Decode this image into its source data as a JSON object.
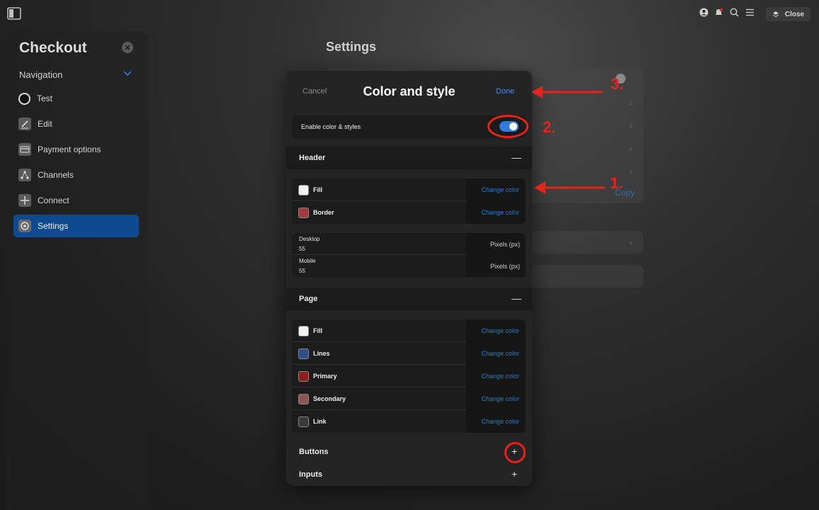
{
  "topbar": {
    "close_label": "Close"
  },
  "sidebar": {
    "title": "Checkout",
    "nav_label": "Navigation",
    "items": [
      {
        "label": "Test",
        "icon": "circle-icon"
      },
      {
        "label": "Edit",
        "icon": "edit-icon"
      },
      {
        "label": "Payment options",
        "icon": "card-icon"
      },
      {
        "label": "Channels",
        "icon": "channels-icon"
      },
      {
        "label": "Connect",
        "icon": "plus-icon"
      },
      {
        "label": "Settings",
        "icon": "gear-icon",
        "active": true
      }
    ]
  },
  "background": {
    "title": "Settings",
    "copy_label": "Copy"
  },
  "modal": {
    "cancel": "Cancel",
    "title": "Color and style",
    "done": "Done",
    "enable_label": "Enable color & styles",
    "enable_on": true,
    "header": {
      "label": "Header",
      "colors": [
        {
          "name": "Fill",
          "swatch": "#f2f2f2",
          "action": "Change color"
        },
        {
          "name": "Border",
          "swatch": "#a23c3c",
          "action": "Change color"
        }
      ],
      "sizes": [
        {
          "label": "Desktop",
          "value": "55",
          "unit": "Pixels (px)"
        },
        {
          "label": "Mobile",
          "value": "55",
          "unit": "Pixels (px)"
        }
      ]
    },
    "page": {
      "label": "Page",
      "colors": [
        {
          "name": "Fill",
          "swatch": "#f2f2f2",
          "action": "Change color"
        },
        {
          "name": "Lines",
          "swatch": "#2e4f87",
          "action": "Change color"
        },
        {
          "name": "Primary",
          "swatch": "#8e1f1f",
          "action": "Change color"
        },
        {
          "name": "Secondary",
          "swatch": "#8f5555",
          "action": "Change color"
        },
        {
          "name": "Link",
          "swatch": "#3a3a3a",
          "action": "Change color"
        }
      ]
    },
    "buttons_label": "Buttons",
    "inputs_label": "Inputs"
  },
  "annotations": {
    "step1": "1.",
    "step2": "2.",
    "step3": "3.",
    "color": "#e8231b"
  }
}
